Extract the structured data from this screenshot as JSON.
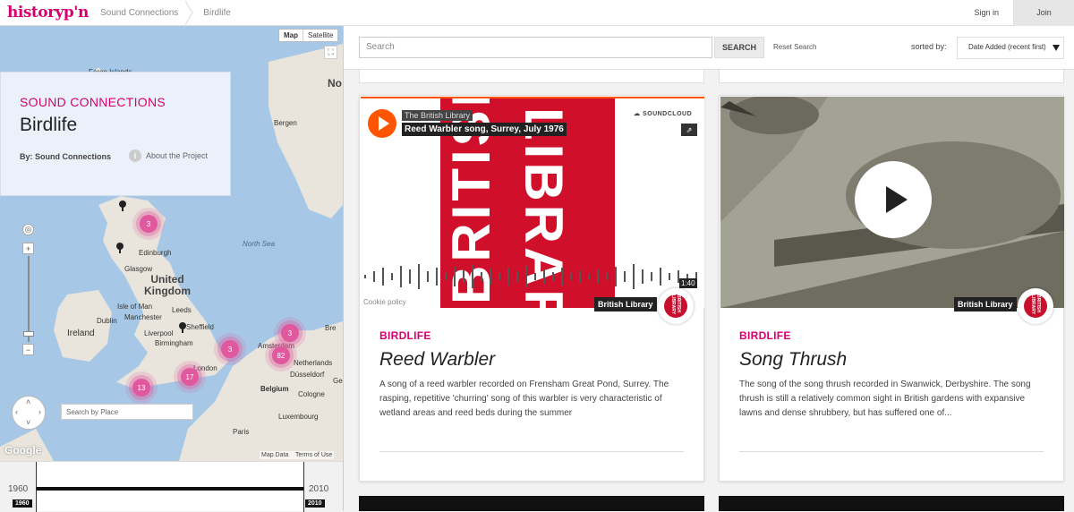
{
  "header": {
    "logo": "historyp'n",
    "breadcrumbs": [
      "Sound Connections",
      "Birdlife"
    ],
    "signin": "Sign in",
    "join": "Join"
  },
  "map": {
    "type_map": "Map",
    "type_satellite": "Satellite",
    "project_pretitle": "SOUND CONNECTIONS",
    "project_title": "Birdlife",
    "project_by": "By: Sound Connections",
    "about": "About the Project",
    "place_search_placeholder": "Search by Place",
    "google": "Google",
    "map_data": "Map Data",
    "terms": "Terms of Use",
    "labels": {
      "faroe": "Faroe Islands",
      "bergen": "Bergen",
      "north_sea": "North Sea",
      "edinburgh": "Edinburgh",
      "glasgow": "Glasgow",
      "uk": "United Kingdom",
      "isle_of_man": "Isle of Man",
      "leeds": "Leeds",
      "dublin": "Dublin",
      "manchester": "Manchester",
      "ireland": "Ireland",
      "liverpool": "Liverpool",
      "sheffield": "Sheffield",
      "birmingham": "Birmingham",
      "london": "London",
      "amsterdam": "Amsterdam",
      "netherlands": "Netherlands",
      "belgium": "Belgium",
      "cologne": "Cologne",
      "dusseldorf": "Düsseldorf",
      "luxembourg": "Luxembourg",
      "paris": "Paris",
      "no": "No",
      "bre": "Bre",
      "ge": "Ge"
    },
    "clusters": [
      "3",
      "3",
      "3",
      "82",
      "17",
      "13"
    ]
  },
  "timeline": {
    "start_year": "1960",
    "end_year": "2010",
    "start_tag": "1960",
    "end_tag": "2010"
  },
  "search": {
    "placeholder": "Search",
    "button": "SEARCH",
    "reset": "Reset Search",
    "sorted_by": "sorted by:",
    "sort_value": "Date Added (recent first)"
  },
  "cards": [
    {
      "category": "BIRDLIFE",
      "title": "Reed Warbler",
      "description": "A song of a reed warbler recorded on Frensham Great Pond, Surrey. The rasping, repetitive 'churring' song of this warbler is very characteristic of wetland areas and reed beds during the summer",
      "owner": "British Library",
      "sc_user": "The British Library",
      "sc_track": "Reed Warbler song, Surrey, July 1976",
      "sc_logo": "SOUNDCLOUD",
      "sc_time": "1:40",
      "sc_cookie": "Cookie policy",
      "art_text_1": "LIBRARY",
      "art_text_2": "BRITISH"
    },
    {
      "category": "BIRDLIFE",
      "title": "Song Thrush",
      "description": "The song of the song thrush recorded in Swanwick, Derbyshire. The song thrush is still a relatively common sight in British gardens with expansive lawns and dense shrubbery, but has suffered one of...",
      "owner": "British Library"
    }
  ],
  "badge_text": "BRITISH LIBRARY",
  "colors": {
    "brand": "#d6006f",
    "soundcloud": "#ff5500",
    "map_water": "#a6c8e6",
    "cluster": "#e0589d"
  }
}
